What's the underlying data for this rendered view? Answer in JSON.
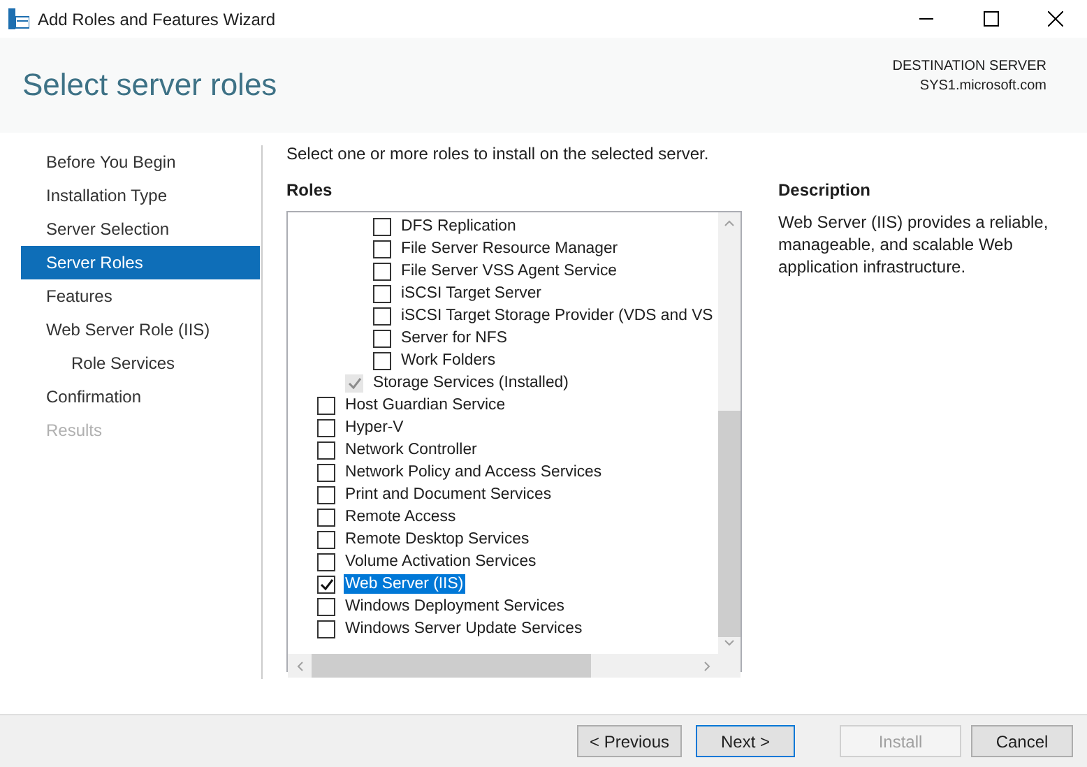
{
  "window": {
    "title": "Add Roles and Features Wizard"
  },
  "header": {
    "title": "Select server roles",
    "destination_label": "DESTINATION SERVER",
    "destination_server": "SYS1.microsoft.com"
  },
  "sidebar": {
    "items": [
      {
        "label": "Before You Begin",
        "selected": false,
        "disabled": false
      },
      {
        "label": "Installation Type",
        "selected": false,
        "disabled": false
      },
      {
        "label": "Server Selection",
        "selected": false,
        "disabled": false
      },
      {
        "label": "Server Roles",
        "selected": true,
        "disabled": false
      },
      {
        "label": "Features",
        "selected": false,
        "disabled": false
      },
      {
        "label": "Web Server Role (IIS)",
        "selected": false,
        "disabled": false,
        "children": [
          {
            "label": "Role Services",
            "selected": false,
            "disabled": false
          }
        ]
      },
      {
        "label": "Confirmation",
        "selected": false,
        "disabled": false
      },
      {
        "label": "Results",
        "selected": false,
        "disabled": true
      }
    ]
  },
  "intro": "Select one or more roles to install on the selected server.",
  "roles": {
    "heading": "Roles",
    "items": [
      {
        "children": [
          {
            "children": [
              {
                "label": "DFS Replication",
                "checked": false,
                "disabled": false,
                "selected": false
              },
              {
                "label": "File Server Resource Manager",
                "checked": false,
                "disabled": false,
                "selected": false
              },
              {
                "label": "File Server VSS Agent Service",
                "checked": false,
                "disabled": false,
                "selected": false
              },
              {
                "label": "iSCSI Target Server",
                "checked": false,
                "disabled": false,
                "selected": false
              },
              {
                "label": "iSCSI Target Storage Provider (VDS and VS",
                "checked": false,
                "disabled": false,
                "selected": false
              },
              {
                "label": "Server for NFS",
                "checked": false,
                "disabled": false,
                "selected": false
              },
              {
                "label": "Work Folders",
                "checked": false,
                "disabled": false,
                "selected": false
              }
            ]
          },
          {
            "label": "Storage Services (Installed)",
            "checked": true,
            "disabled": true,
            "selected": false
          }
        ]
      },
      {
        "label": "Host Guardian Service",
        "checked": false,
        "disabled": false,
        "selected": false
      },
      {
        "label": "Hyper-V",
        "checked": false,
        "disabled": false,
        "selected": false
      },
      {
        "label": "Network Controller",
        "checked": false,
        "disabled": false,
        "selected": false
      },
      {
        "label": "Network Policy and Access Services",
        "checked": false,
        "disabled": false,
        "selected": false
      },
      {
        "label": "Print and Document Services",
        "checked": false,
        "disabled": false,
        "selected": false
      },
      {
        "label": "Remote Access",
        "checked": false,
        "disabled": false,
        "selected": false
      },
      {
        "label": "Remote Desktop Services",
        "checked": false,
        "disabled": false,
        "selected": false
      },
      {
        "label": "Volume Activation Services",
        "checked": false,
        "disabled": false,
        "selected": false
      },
      {
        "label": "Web Server (IIS)",
        "checked": true,
        "disabled": false,
        "selected": true
      },
      {
        "label": "Windows Deployment Services",
        "checked": false,
        "disabled": false,
        "selected": false
      },
      {
        "label": "Windows Server Update Services",
        "checked": false,
        "disabled": false,
        "selected": false
      }
    ]
  },
  "description": {
    "heading": "Description",
    "text": "Web Server (IIS) provides a reliable, manageable, and scalable Web application infrastructure."
  },
  "buttons": [
    {
      "label": "< Previous",
      "disabled": false,
      "focused": false
    },
    {
      "label": "Next >",
      "disabled": false,
      "focused": true
    },
    {
      "label": "Install",
      "disabled": true,
      "focused": false
    },
    {
      "label": "Cancel",
      "disabled": false,
      "focused": false
    }
  ]
}
